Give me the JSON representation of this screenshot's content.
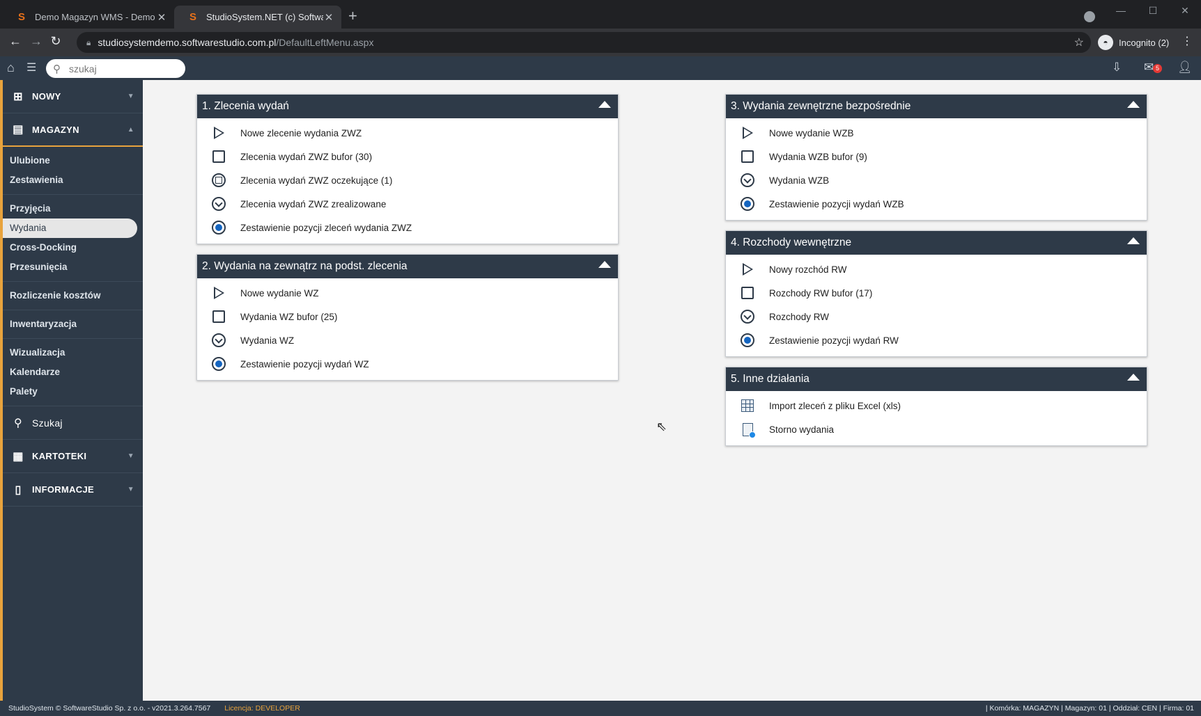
{
  "browser": {
    "tabs": [
      {
        "title": "Demo Magazyn WMS - Demo on",
        "favicon": "S",
        "active": false
      },
      {
        "title": "StudioSystem.NET (c) SoftwareStudio",
        "favicon": "S",
        "active": true
      }
    ],
    "url_host": "studiosystemdemo.softwarestudio.com.pl",
    "url_path": "/DefaultLeftMenu.aspx",
    "incognito_label": "Incognito (2)"
  },
  "topbar": {
    "search_placeholder": "szukaj",
    "mail_count": "5"
  },
  "sidebar": {
    "nowy": "NOWY",
    "magazyn": "MAGAZYN",
    "groups": [
      [
        "Ulubione",
        "Zestawienia"
      ],
      [
        "Przyjęcia",
        "Wydania",
        "Cross-Docking",
        "Przesunięcia"
      ],
      [
        "Rozliczenie kosztów"
      ],
      [
        "Inwentaryzacja"
      ],
      [
        "Wizualizacja",
        "Kalendarze",
        "Palety"
      ]
    ],
    "active_item": "Wydania",
    "szukaj": "Szukaj",
    "kartoteki": "KARTOTEKI",
    "informacje": "INFORMACJE"
  },
  "panels": [
    {
      "title": "1. Zlecenia wydań",
      "items": [
        {
          "icon": "play-icon",
          "label": "Nowe zlecenie wydania ZWZ"
        },
        {
          "icon": "square-icon",
          "label": "Zlecenia wydań ZWZ bufor (30)"
        },
        {
          "icon": "circle-square-icon",
          "label": "Zlecenia wydań ZWZ oczekujące (1)"
        },
        {
          "icon": "circle-chevron-icon",
          "label": "Zlecenia wydań ZWZ zrealizowane"
        },
        {
          "icon": "radio-dot-icon",
          "label": "Zestawienie pozycji zleceń wydania ZWZ"
        }
      ]
    },
    {
      "title": "2. Wydania na zewnątrz na podst. zlecenia",
      "items": [
        {
          "icon": "play-icon",
          "label": "Nowe wydanie WZ"
        },
        {
          "icon": "square-icon",
          "label": "Wydania WZ bufor (25)"
        },
        {
          "icon": "circle-chevron-icon",
          "label": "Wydania WZ"
        },
        {
          "icon": "radio-dot-icon",
          "label": "Zestawienie pozycji wydań WZ"
        }
      ]
    },
    {
      "title": "3. Wydania zewnętrzne bezpośrednie",
      "items": [
        {
          "icon": "play-icon",
          "label": "Nowe wydanie WZB"
        },
        {
          "icon": "square-icon",
          "label": "Wydania WZB bufor (9)"
        },
        {
          "icon": "circle-chevron-icon",
          "label": "Wydania WZB"
        },
        {
          "icon": "radio-dot-icon",
          "label": "Zestawienie pozycji wydań WZB"
        }
      ]
    },
    {
      "title": "4. Rozchody wewnętrzne",
      "items": [
        {
          "icon": "play-icon",
          "label": "Nowy rozchód RW"
        },
        {
          "icon": "square-icon",
          "label": "Rozchody RW bufor (17)"
        },
        {
          "icon": "circle-chevron-icon",
          "label": "Rozchody RW"
        },
        {
          "icon": "radio-dot-icon",
          "label": "Zestawienie pozycji wydań RW"
        }
      ]
    },
    {
      "title": "5. Inne działania",
      "items": [
        {
          "icon": "excel-grid-icon",
          "label": "Import zleceń z pliku Excel (xls)"
        },
        {
          "icon": "document-cancel-icon",
          "label": "Storno wydania"
        }
      ]
    }
  ],
  "footer": {
    "copyright": "StudioSystem © SoftwareStudio Sp. z o.o. - v2021.3.264.7567",
    "license_label": "Licencja:",
    "license_value": "DEVELOPER",
    "status": "| Komórka: MAGAZYN | Magazyn: 01 | Oddział: CEN | Firma: 01"
  }
}
